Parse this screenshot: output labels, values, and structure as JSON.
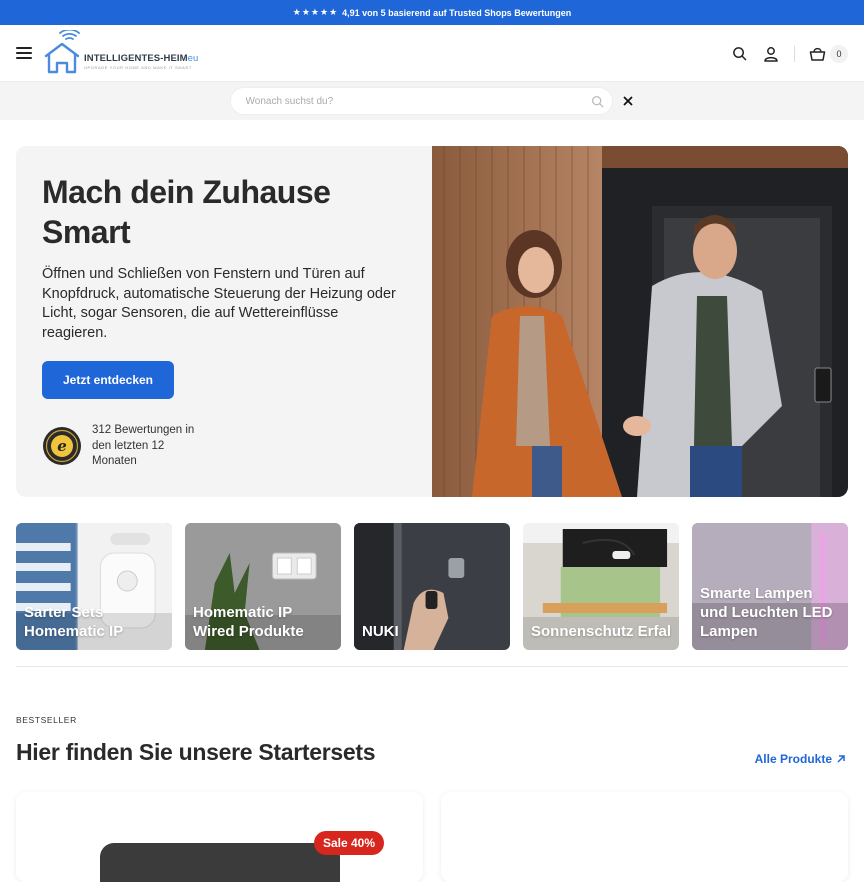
{
  "announcement": {
    "stars": "★★★★★",
    "text": "4,91 von 5 basierend auf Trusted Shops Bewertungen"
  },
  "header": {
    "logo_main": "INTELLIGENTES-HEIM",
    "logo_suffix": "eu",
    "logo_tagline": "UPGRADE YOUR HOME AND MAKE IT SMART",
    "cart_count": "0"
  },
  "search": {
    "placeholder": "Wonach suchst du?"
  },
  "hero": {
    "title": "Mach dein Zuhause Smart",
    "description": "Öffnen und Schließen von Fenstern und Türen auf Knopfdruck, automatische Steuerung der Heizung oder Licht, sogar Sensoren, die auf Wettereinflüsse reagieren.",
    "cta": "Jetzt entdecken",
    "trust_text": "312 Bewertungen in den letzten 12 Monaten"
  },
  "categories": [
    {
      "label": "Sarter Sets Homematic IP"
    },
    {
      "label": "Homematic IP Wired Produkte"
    },
    {
      "label": "NUKI"
    },
    {
      "label": "Sonnenschutz Erfal"
    },
    {
      "label": "Smarte Lampen und Leuchten LED Lampen"
    }
  ],
  "bestseller": {
    "eyebrow": "BESTSELLER",
    "title": "Hier finden Sie unsere Startersets",
    "all_link": "Alle Produkte",
    "sale_badge": "Sale 40%"
  },
  "colors": {
    "accent": "#1f66d9",
    "sale": "#d7261e",
    "hero_bg": "#f4f4f4"
  }
}
